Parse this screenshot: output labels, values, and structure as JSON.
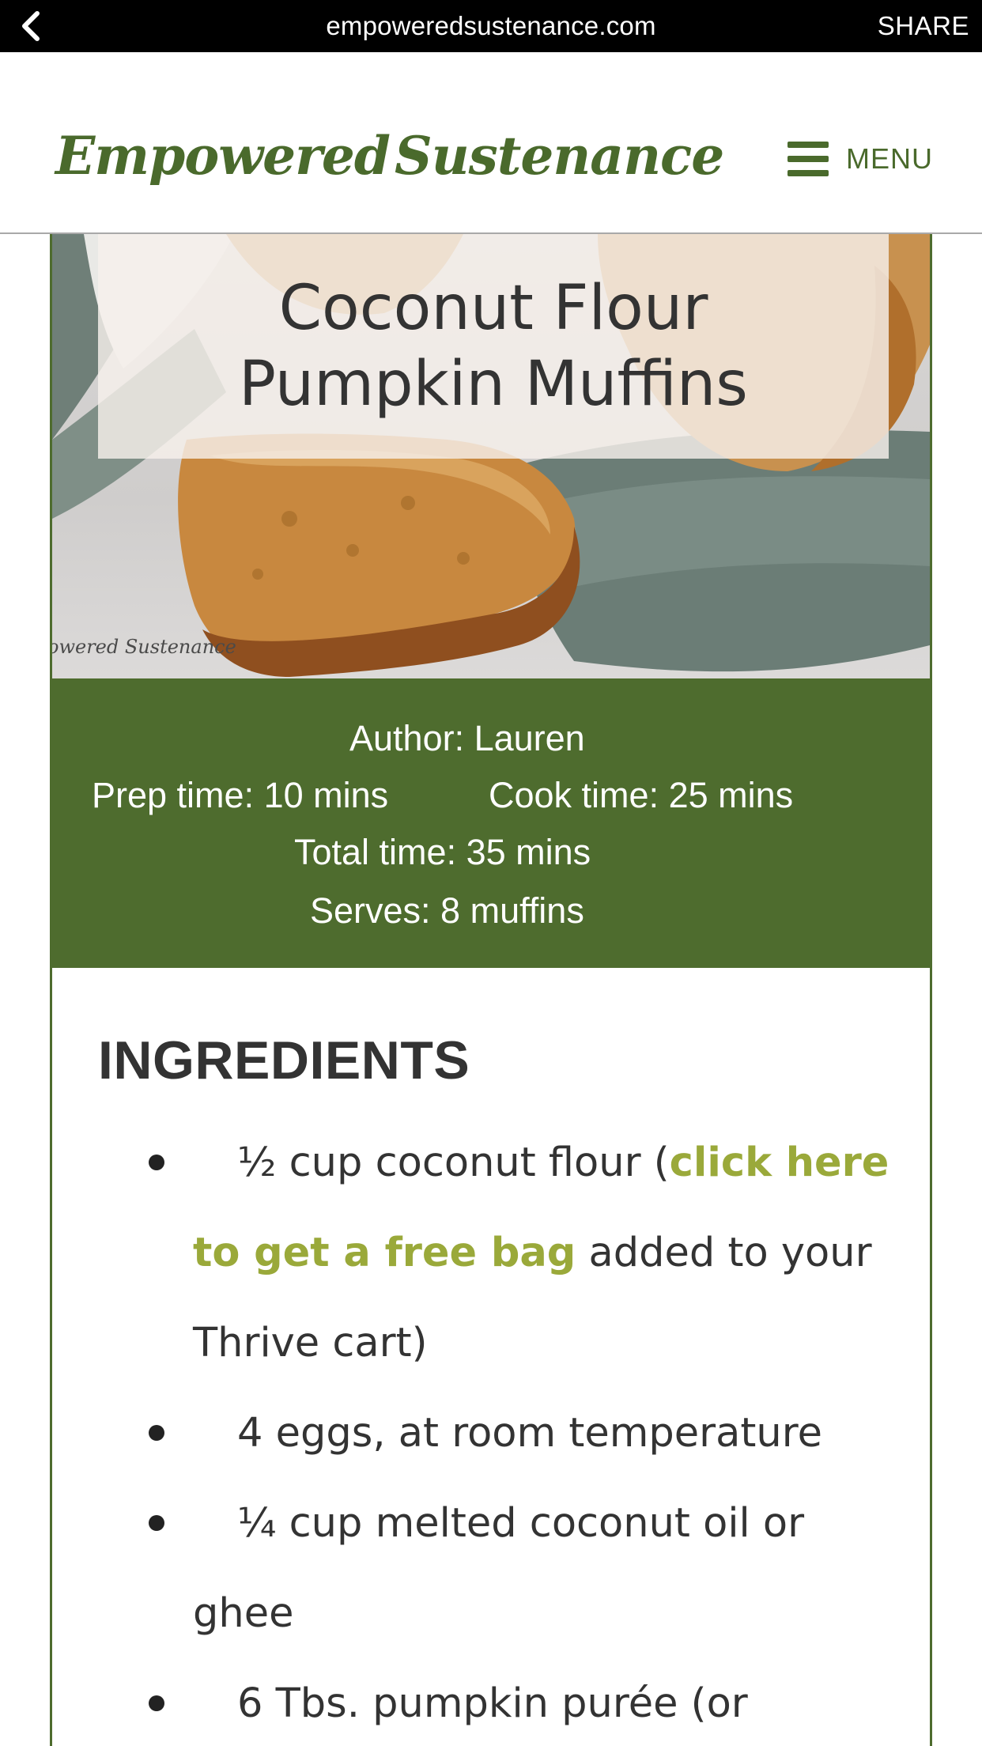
{
  "browser": {
    "url": "empoweredsustenance.com",
    "share_label": "SHARE"
  },
  "site": {
    "logo_left": "Empowered",
    "logo_right": "Sustenance",
    "menu_label": "MENU"
  },
  "recipe": {
    "title": "Coconut Flour Pumpkin Muffins",
    "image_watermark": "owered Sustenance",
    "author": "Author: Lauren",
    "prep_time": "Prep time:  10 mins",
    "cook_time": "Cook time:  25 mins",
    "total_time": "Total time:  35 mins",
    "serves": "Serves: 8 muffins"
  },
  "ingredients": {
    "heading": "INGREDIENTS",
    "items": [
      {
        "before_link": "½ cup coconut flour (",
        "link": "click here to get a free bag",
        "after_link": " added to your Thrive cart)"
      },
      {
        "text": "4 eggs, at room temperature"
      },
      {
        "text": "¼ cup melted coconut oil or ghee"
      },
      {
        "text": "6 Tbs. pumpkin purée (or"
      }
    ]
  },
  "colors": {
    "brand_green": "#4e6c2e",
    "link_green": "#9aa93a",
    "radish_red": "#d92d32"
  },
  "icons": [
    "chevron-left-icon",
    "hamburger-menu-icon",
    "radish-logo-icon"
  ]
}
